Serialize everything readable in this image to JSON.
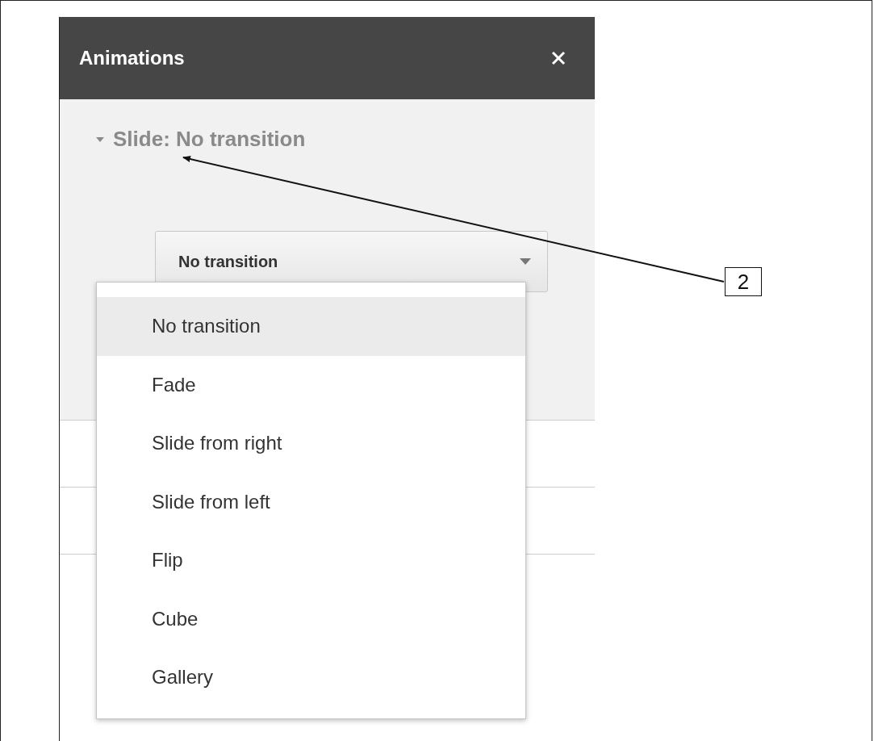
{
  "panel": {
    "title": "Animations"
  },
  "section": {
    "title": "Slide: No transition",
    "expanded": true
  },
  "transition_select": {
    "value": "No transition",
    "open": true
  },
  "menu": [
    {
      "label": "No transition",
      "selected": true
    },
    {
      "label": "Fade",
      "selected": false
    },
    {
      "label": "Slide from right",
      "selected": false
    },
    {
      "label": "Slide from left",
      "selected": false
    },
    {
      "label": "Flip",
      "selected": false
    },
    {
      "label": "Cube",
      "selected": false
    },
    {
      "label": "Gallery",
      "selected": false
    }
  ],
  "callout": {
    "label": "2"
  }
}
